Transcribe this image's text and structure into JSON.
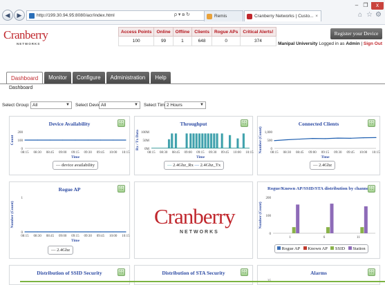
{
  "browser": {
    "url": "http://199.30.94.95:8080/acr/index.html",
    "addr_icons": "ρ ▾ ᴃ ↻",
    "tabs": [
      {
        "label": "Remis",
        "active": false
      },
      {
        "label": "Cranberry Networks | Custo...",
        "active": true
      }
    ],
    "tab_close": "×",
    "window_buttons": {
      "minimize": "–",
      "restore": "❐",
      "close": "x"
    }
  },
  "header": {
    "logo_text": "Cranberry",
    "logo_sub": "NETWORKS",
    "stats_headers": [
      "Access Points",
      "Online",
      "Offline",
      "Clients",
      "Rogue APs",
      "Critical Alerts!"
    ],
    "stats_values": [
      "100",
      "99",
      "1",
      "648",
      "0",
      "374"
    ],
    "register_label": "Register your Device",
    "org": "Manipal University",
    "logged_text": "Logged in as",
    "user": "Admin",
    "signout": "Sign Out"
  },
  "menu": {
    "items": [
      "Dashboard",
      "Monitor",
      "Configure",
      "Administration",
      "Help"
    ],
    "active_index": 0,
    "submenu": "Dashboard"
  },
  "filters": {
    "group_label": "Select Group:",
    "group_value": "All",
    "device_label": "Select Device:",
    "device_value": "All",
    "time_label": "Select Time:",
    "time_value": "2 Hours",
    "arrow": "▼"
  },
  "widgets": {
    "device_availability": {
      "title": "Device Availability",
      "legend": "device availability",
      "ylabel": "Count",
      "xlabel": "Time"
    },
    "throughput": {
      "title": "Throughput",
      "legend_a": "2.4Ghz_Rx",
      "legend_b": "2.4Ghz_Tx",
      "ylabel": "Rx / Tx Data",
      "xlabel": "Time"
    },
    "connected_clients": {
      "title": "Connected Clients",
      "legend": "2.4Ghz",
      "ylabel": "Number (Count)",
      "xlabel": "Time"
    },
    "rogue_ap": {
      "title": "Rogue AP",
      "legend": "2.4Ghz",
      "ylabel": "Number (Count)",
      "xlabel": "Time"
    },
    "distribution": {
      "title": "Rogue/Known AP/SSID/STA distribution by channel",
      "ylabel": "Number (Count)",
      "legend": [
        "Rogue AP",
        "Known AP",
        "SSID",
        "Station"
      ]
    },
    "ssid_security": {
      "title": "Distribution of SSID Security"
    },
    "sta_security": {
      "title": "Distribution of STA Security"
    },
    "alarms": {
      "title": "Alarms",
      "ytick": "35"
    },
    "widget_button": "⛶"
  },
  "big_logo": {
    "text": "Cranberry",
    "sub": "NETWORKS"
  },
  "colors": {
    "brand_red": "#c0272d",
    "title_blue": "#2c4aa3",
    "series_blue": "#1f5fb0",
    "throughput_teal": "#2aa0a0",
    "rogue": "#3b6fb6",
    "known": "#c0392b",
    "ssid": "#8ab24a",
    "station": "#8e6bb8"
  },
  "chart_data": [
    {
      "type": "line",
      "title": "Device Availability",
      "xlabel": "Time",
      "ylabel": "Count",
      "x": [
        "08:15",
        "08:30",
        "08:45",
        "09:00",
        "09:15",
        "09:30",
        "09:45",
        "10:00",
        "10:15"
      ],
      "yticks": [
        "0",
        "100",
        "200"
      ],
      "ylim": [
        0,
        200
      ],
      "series": [
        {
          "name": "device availability",
          "values": [
            100,
            100,
            100,
            100,
            100,
            100,
            100,
            100,
            100
          ]
        }
      ]
    },
    {
      "type": "area",
      "title": "Throughput",
      "xlabel": "Time",
      "ylabel": "Rx / Tx Data",
      "x": [
        "08:15",
        "08:30",
        "08:45",
        "09:00",
        "09:15",
        "09:30",
        "09:45",
        "10:00",
        "10:15"
      ],
      "yticks": [
        "0M",
        "50M",
        "100M"
      ],
      "ylim": [
        0,
        100
      ],
      "bursts": [
        {
          "at": 0.18,
          "v": 55
        },
        {
          "at": 0.21,
          "v": 90
        },
        {
          "at": 0.25,
          "v": 90
        },
        {
          "at": 0.36,
          "v": 90
        },
        {
          "at": 0.4,
          "v": 90
        },
        {
          "at": 0.43,
          "v": 90
        },
        {
          "at": 0.46,
          "v": 90
        },
        {
          "at": 0.49,
          "v": 90
        },
        {
          "at": 0.52,
          "v": 90
        },
        {
          "at": 0.55,
          "v": 90
        },
        {
          "at": 0.58,
          "v": 90
        },
        {
          "at": 0.61,
          "v": 90
        },
        {
          "at": 0.64,
          "v": 90
        },
        {
          "at": 0.67,
          "v": 90
        },
        {
          "at": 0.72,
          "v": 90
        },
        {
          "at": 0.8,
          "v": 80
        },
        {
          "at": 0.88,
          "v": 60
        },
        {
          "at": 0.94,
          "v": 90
        }
      ],
      "series": [
        {
          "name": "2.4Ghz_Rx"
        },
        {
          "name": "2.4Ghz_Tx"
        }
      ]
    },
    {
      "type": "line",
      "title": "Connected Clients",
      "xlabel": "Time",
      "ylabel": "Number (Count)",
      "x": [
        "08:15",
        "08:30",
        "08:45",
        "09:00",
        "09:15",
        "09:30",
        "09:45",
        "10:00",
        "10:15"
      ],
      "yticks": [
        "0",
        "500",
        "1,000"
      ],
      "ylim": [
        0,
        1000
      ],
      "series": [
        {
          "name": "2.4Ghz",
          "values": [
            470,
            520,
            560,
            600,
            590,
            620,
            610,
            640,
            650
          ]
        }
      ]
    },
    {
      "type": "line",
      "title": "Rogue AP",
      "xlabel": "Time",
      "ylabel": "Number (Count)",
      "x": [
        "08:15",
        "08:30",
        "08:45",
        "09:00",
        "09:15",
        "09:30",
        "09:45",
        "10:00",
        "10:15"
      ],
      "yticks": [
        "0",
        "1"
      ],
      "ylim": [
        0,
        1
      ],
      "series": [
        {
          "name": "2.4Ghz",
          "values": [
            0,
            0,
            0,
            0,
            0,
            0,
            0,
            0,
            0
          ]
        }
      ]
    },
    {
      "type": "bar",
      "title": "Rogue/Known AP/SSID/STA distribution by channel",
      "ylabel": "Number (Count)",
      "categories": [
        "1",
        "6",
        "11"
      ],
      "yticks": [
        "0",
        "100",
        "200"
      ],
      "ylim": [
        0,
        200
      ],
      "series": [
        {
          "name": "Rogue AP",
          "values": [
            0,
            0,
            0
          ]
        },
        {
          "name": "Known AP",
          "values": [
            0,
            0,
            0
          ]
        },
        {
          "name": "SSID",
          "values": [
            34,
            34,
            34
          ]
        },
        {
          "name": "Station",
          "values": [
            160,
            165,
            150
          ]
        }
      ]
    }
  ]
}
